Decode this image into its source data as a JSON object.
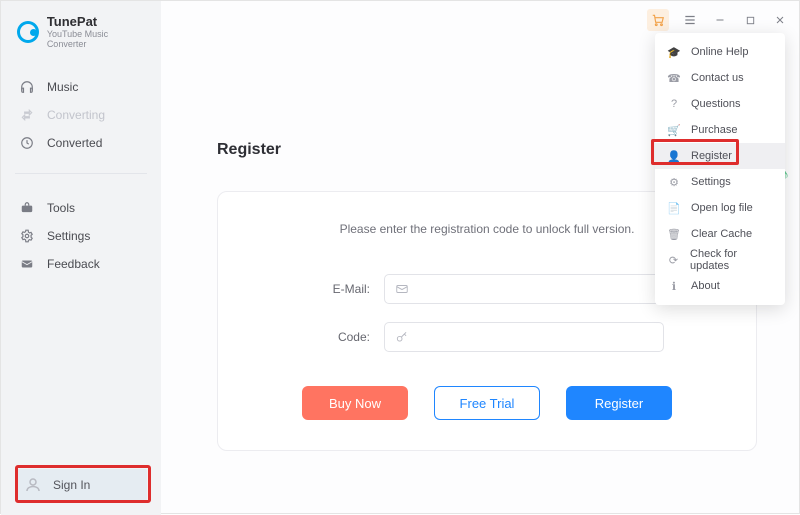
{
  "brand": {
    "title": "TunePat",
    "subtitle": "YouTube Music Converter"
  },
  "sidebar": {
    "primary": [
      {
        "label": "Music",
        "icon": "headphones-icon"
      },
      {
        "label": "Converting",
        "icon": "converting-icon",
        "muted": true
      },
      {
        "label": "Converted",
        "icon": "clock-icon"
      }
    ],
    "secondary": [
      {
        "label": "Tools",
        "icon": "toolbox-icon"
      },
      {
        "label": "Settings",
        "icon": "gear-icon"
      },
      {
        "label": "Feedback",
        "icon": "mail-icon"
      }
    ],
    "signin_label": "Sign In"
  },
  "topbar": {
    "cart_icon": "cart-icon",
    "menu_icon": "menu-icon",
    "minimize_icon": "minimize-icon",
    "maximize_icon": "maximize-icon",
    "close_icon": "close-icon"
  },
  "page": {
    "title": "Register"
  },
  "card": {
    "message": "Please enter the registration code to unlock full version.",
    "email_label": "E-Mail:",
    "email_placeholder": "",
    "code_label": "Code:",
    "code_placeholder": "",
    "buy_label": "Buy Now",
    "trial_label": "Free Trial",
    "register_label": "Register"
  },
  "dropdown": {
    "items": [
      {
        "label": "Online Help",
        "icon": "graduation-icon"
      },
      {
        "label": "Contact us",
        "icon": "phone-icon"
      },
      {
        "label": "Questions",
        "icon": "question-icon"
      },
      {
        "label": "Purchase",
        "icon": "cart-icon"
      },
      {
        "label": "Register",
        "icon": "user-plus-icon",
        "selected": true
      },
      {
        "label": "Settings",
        "icon": "gear-icon"
      },
      {
        "label": "Open log file",
        "icon": "document-icon"
      },
      {
        "label": "Clear Cache",
        "icon": "trash-icon"
      },
      {
        "label": "Check for updates",
        "icon": "refresh-icon"
      },
      {
        "label": "About",
        "icon": "info-icon"
      }
    ]
  }
}
